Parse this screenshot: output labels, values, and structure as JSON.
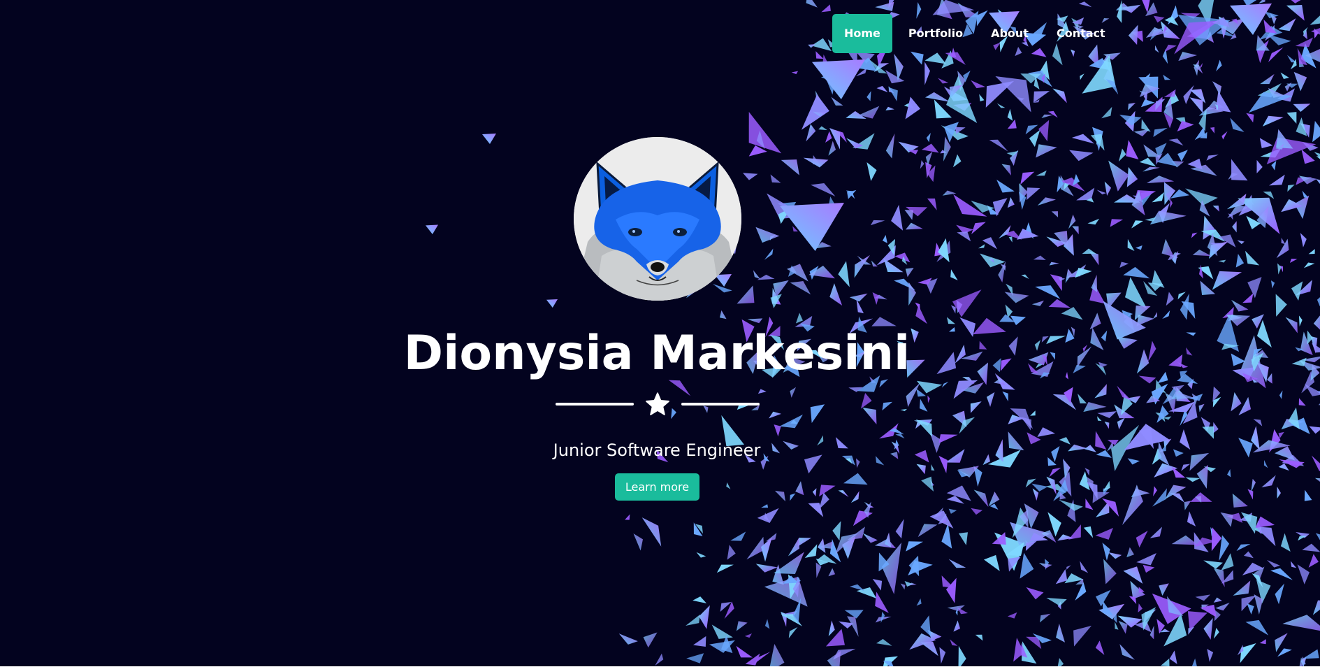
{
  "navbar": {
    "items": [
      {
        "label": "Home",
        "active": true
      },
      {
        "label": "Portfolio",
        "active": false
      },
      {
        "label": "About",
        "active": false
      },
      {
        "label": "Contact",
        "active": false
      }
    ]
  },
  "hero": {
    "avatar_icon": "fox-icon",
    "name": "Dionysia Markesini",
    "divider_icon": "star-icon",
    "subtitle": "Junior Software Engineer",
    "cta_label": "Learn more"
  },
  "colors": {
    "background": "#03031f",
    "accent": "#1abc9c",
    "text": "#ffffff",
    "shard_light": "#7fd8ff",
    "shard_mid": "#8f8bff",
    "shard_deep": "#9b5cff"
  }
}
